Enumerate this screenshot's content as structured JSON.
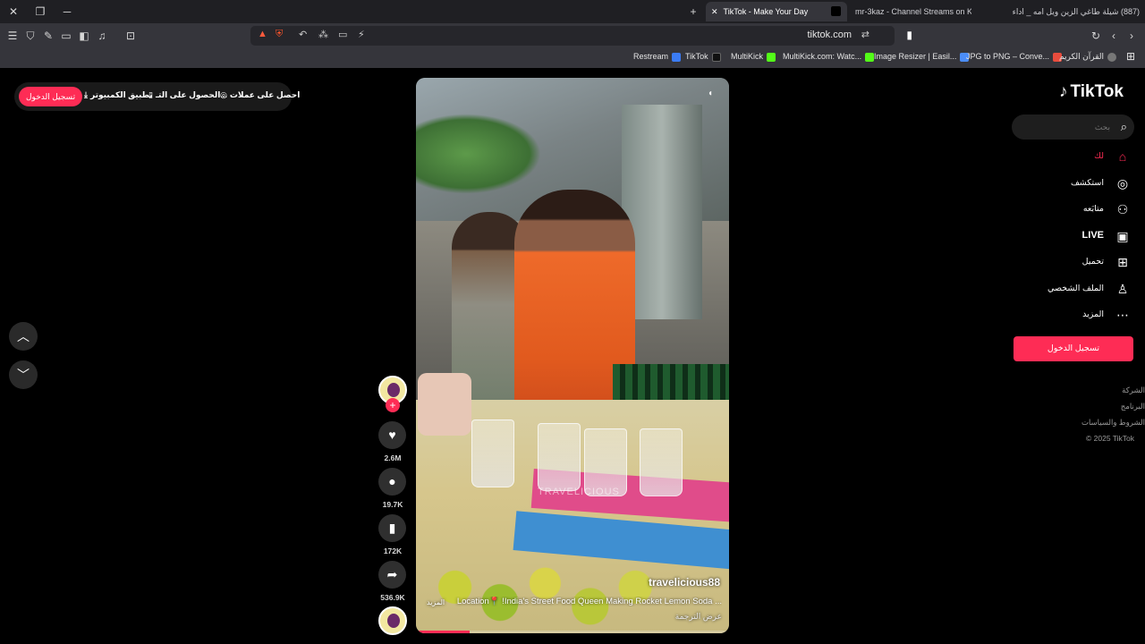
{
  "browser": {
    "tabs": [
      {
        "label": "TikTok - Make Your Day",
        "active": true
      },
      {
        "label": "mr-3kaz - Channel Streams on Kick",
        "active": false
      },
      {
        "label": "(887) شيلة طاغي الزين ويل امه _ اداء",
        "active": false
      }
    ],
    "url": "tiktok.com",
    "bookmarks": [
      {
        "label": "Restream",
        "color": "#3b7cf5"
      },
      {
        "label": "TikTok",
        "color": "#111111"
      },
      {
        "label": "MultiKick",
        "color": "#53fc18"
      },
      {
        "label": "MultiKick.com: Watc...",
        "color": "#53fc18"
      },
      {
        "label": "Image Resizer | Easil...",
        "color": "#4b8df8"
      },
      {
        "label": "JPG to PNG – Conve...",
        "color": "#e84c3d"
      },
      {
        "label": "القرآن الكريم",
        "color": "#777777"
      }
    ]
  },
  "topleft": {
    "login": "تسجيل الدخول",
    "desktop_app": "تطبيق الكمبيوتر",
    "get_app": "الحصول على التـ...",
    "get_coins": "احصل على عملات"
  },
  "video": {
    "watermark": "TRAVELICIOUS",
    "author": "travelicious88",
    "caption": "Location📍 !India's Street Food Queen Making Rocket Lemon Soda ...",
    "more": "المزيد",
    "translate": "عرض الترجمة",
    "progress": 0.17
  },
  "actions": {
    "likes": "2.6M",
    "comments": "19.7K",
    "saves": "172K",
    "shares": "536.9K"
  },
  "sidebar": {
    "logo": "TikTok",
    "search_placeholder": "بحث",
    "nav": [
      {
        "label": "لك",
        "icon": "home-icon",
        "active": true
      },
      {
        "label": "استكشف",
        "icon": "compass-icon",
        "active": false
      },
      {
        "label": "متابَعه",
        "icon": "following-icon",
        "active": false
      },
      {
        "label": "LIVE",
        "icon": "live-icon",
        "active": false
      },
      {
        "label": "تحميل",
        "icon": "upload-icon",
        "active": false
      },
      {
        "label": "الملف الشخصي",
        "icon": "profile-icon",
        "active": false
      },
      {
        "label": "المزيد",
        "icon": "more-icon",
        "active": false
      }
    ],
    "login_button": "تسجيل الدخول",
    "footer": [
      "الشركة",
      "البرنامج",
      "الشروط والسياسات",
      "© 2025 TikTok"
    ]
  },
  "colors": {
    "accent": "#fe2c55",
    "background": "#000000",
    "chrome": "#35353b"
  }
}
